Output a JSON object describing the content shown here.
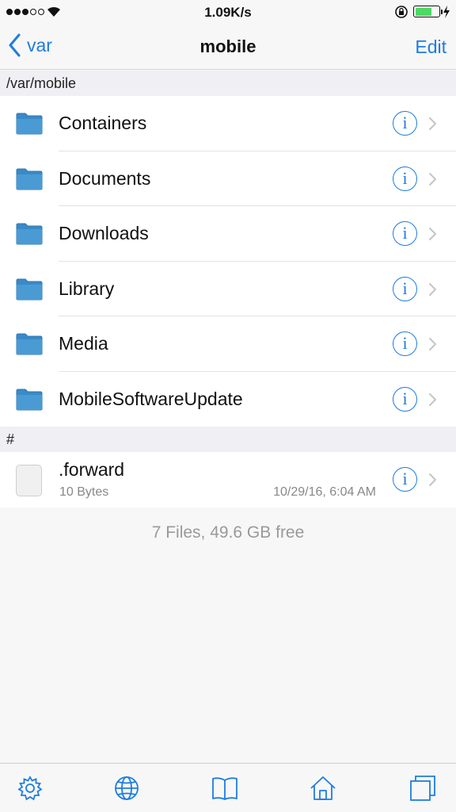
{
  "status_bar": {
    "rate": "1.09K/s"
  },
  "nav": {
    "back_label": "var",
    "title": "mobile",
    "edit_label": "Edit"
  },
  "path_header": "/var/mobile",
  "folders": [
    {
      "name": "Containers"
    },
    {
      "name": "Documents"
    },
    {
      "name": "Downloads"
    },
    {
      "name": "Library"
    },
    {
      "name": "Media"
    },
    {
      "name": "MobileSoftwareUpdate"
    }
  ],
  "files_header": "#",
  "files": [
    {
      "name": ".forward",
      "size": "10 Bytes",
      "date": "10/29/16, 6:04 AM"
    }
  ],
  "footer": "7 Files, 49.6 GB free",
  "icons": {
    "folder": "folder-icon",
    "info": "info-icon",
    "chevron": "chevron-right-icon",
    "tabs": [
      "gear-icon",
      "globe-icon",
      "book-icon",
      "home-icon",
      "windows-icon"
    ]
  },
  "colors": {
    "accent": "#1e7ce0",
    "folder": "#4a9ad4",
    "battery": "#4cd964"
  },
  "battery_level": 0.7
}
